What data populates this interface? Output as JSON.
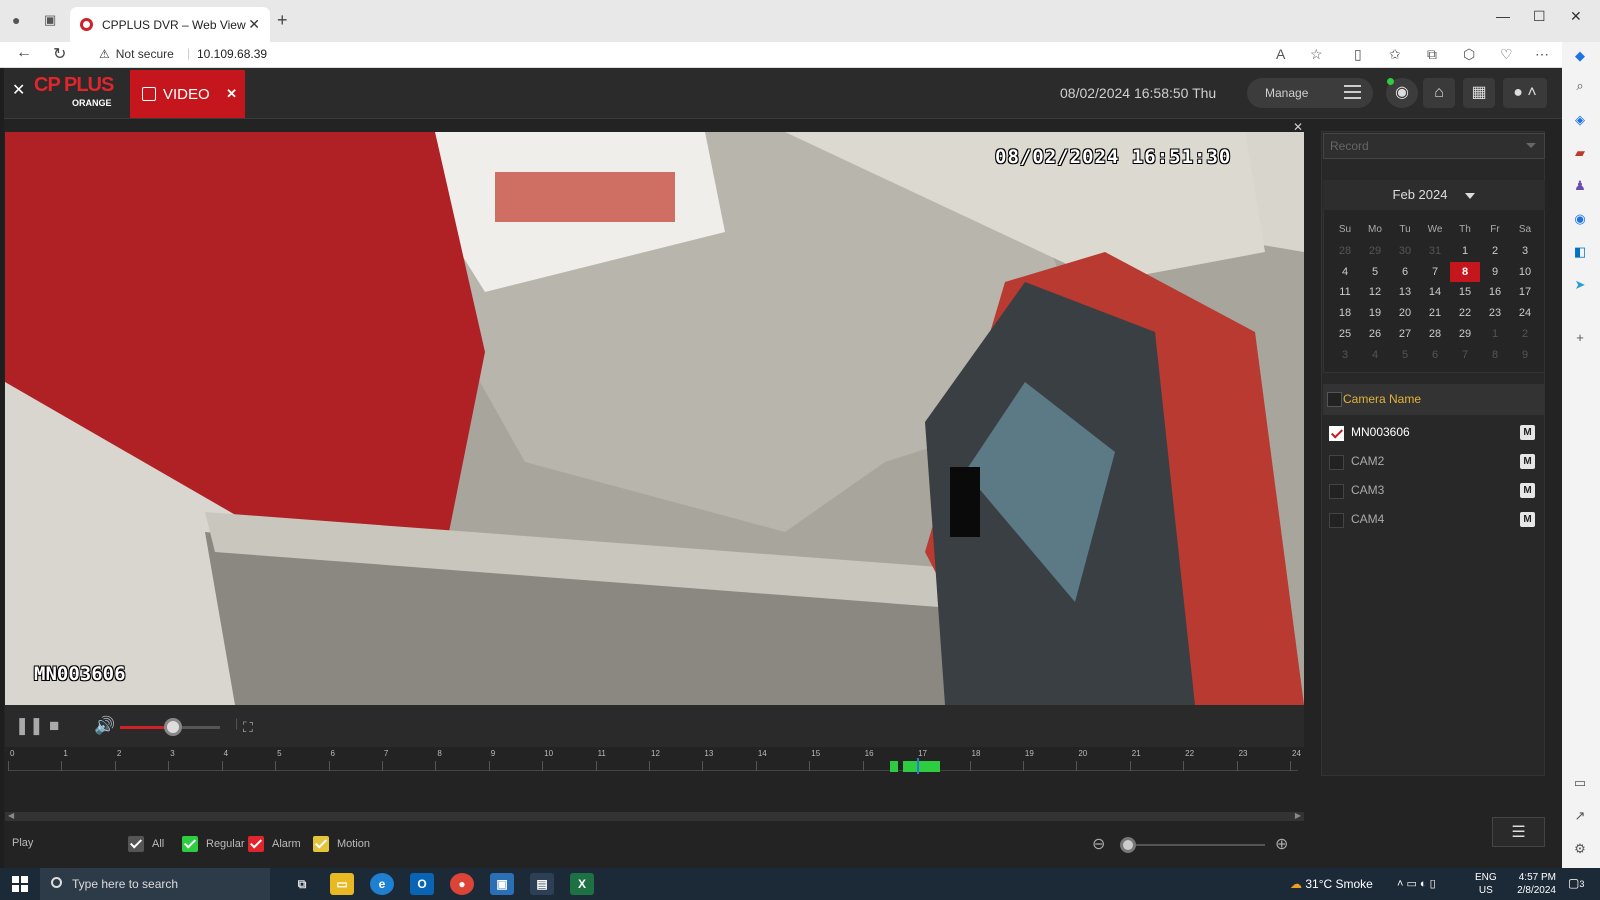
{
  "browser": {
    "tab_title": "CPPLUS DVR – Web View",
    "not_secure": "Not secure",
    "url": "10.109.68.39"
  },
  "app": {
    "logo_text": "CP PLUS",
    "logo_sub": "ORANGE",
    "video_tab": "VIDEO",
    "clock": "08/02/2024 16:58:50 Thu",
    "manage": "Manage"
  },
  "video": {
    "osd_time": "08/02/2024 16:51:30",
    "osd_camera": "MN003606"
  },
  "timeline": {
    "hours": [
      "0",
      "1",
      "2",
      "3",
      "4",
      "5",
      "6",
      "7",
      "8",
      "9",
      "10",
      "11",
      "12",
      "13",
      "14",
      "15",
      "16",
      "17",
      "18",
      "19",
      "20",
      "21",
      "22",
      "23",
      "24"
    ],
    "recordings": [
      {
        "type": "Regular",
        "start_hour": 16.5,
        "end_hour": 16.65
      },
      {
        "type": "Regular",
        "start_hour": 16.75,
        "end_hour": 17.45
      }
    ],
    "current_hour": 16.86
  },
  "bottom": {
    "play": "Play",
    "legend": [
      {
        "label": "All",
        "color": "#555555"
      },
      {
        "label": "Regular",
        "color": "#2ecc40"
      },
      {
        "label": "Alarm",
        "color": "#e0252c"
      },
      {
        "label": "Motion",
        "color": "#e3c53c"
      }
    ]
  },
  "panel": {
    "record_placeholder": "Record",
    "month": "Feb 2024",
    "days_of_week": [
      "Su",
      "Mo",
      "Tu",
      "We",
      "Th",
      "Fr",
      "Sa"
    ],
    "weeks": [
      [
        "28",
        "29",
        "30",
        "31",
        "1",
        "2",
        "3"
      ],
      [
        "4",
        "5",
        "6",
        "7",
        "8",
        "9",
        "10"
      ],
      [
        "11",
        "12",
        "13",
        "14",
        "15",
        "16",
        "17"
      ],
      [
        "18",
        "19",
        "20",
        "21",
        "22",
        "23",
        "24"
      ],
      [
        "25",
        "26",
        "27",
        "28",
        "29",
        "1",
        "2"
      ],
      [
        "3",
        "4",
        "5",
        "6",
        "7",
        "8",
        "9"
      ]
    ],
    "selected_day": "8",
    "camera_header": "Camera Name",
    "cameras": [
      {
        "name": "MN003606",
        "checked": true,
        "badge": "M"
      },
      {
        "name": "CAM2",
        "checked": false,
        "badge": "M"
      },
      {
        "name": "CAM3",
        "checked": false,
        "badge": "M"
      },
      {
        "name": "CAM4",
        "checked": false,
        "badge": "M"
      }
    ]
  },
  "taskbar": {
    "search_placeholder": "Type here to search",
    "weather": "31°C  Smoke",
    "lang": "ENG",
    "region": "US",
    "time": "4:57 PM",
    "date": "2/8/2024",
    "notif_count": "3"
  },
  "colors": {
    "accent": "#c4161c",
    "regular": "#2ecc40"
  }
}
